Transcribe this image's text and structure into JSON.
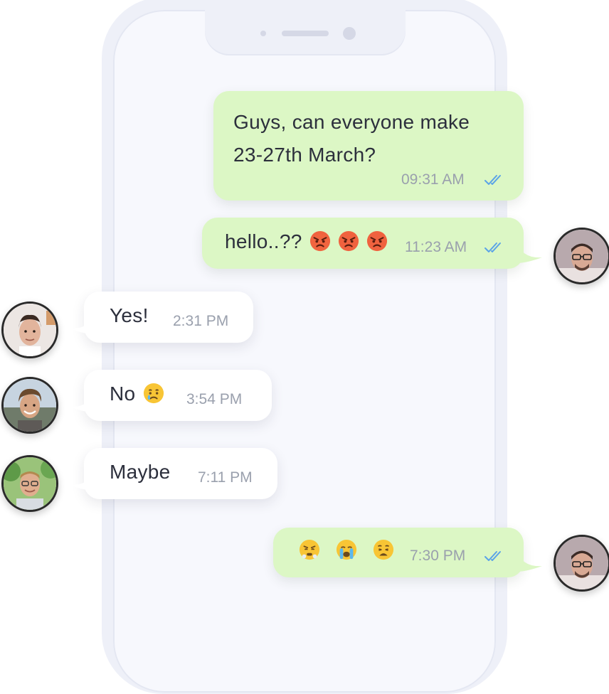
{
  "messages": [
    {
      "id": "m1",
      "direction": "sent",
      "lines": [
        "Guys, can everyone make",
        "23-27th March?"
      ],
      "time": "09:31 AM",
      "read": true
    },
    {
      "id": "m2",
      "direction": "sent",
      "text": "hello..??",
      "emojis": [
        "angry-face",
        "angry-face",
        "angry-face"
      ],
      "time": "11:23 AM",
      "read": true,
      "avatar": "man-glasses-avatar"
    },
    {
      "id": "m3",
      "direction": "received",
      "text": "Yes!",
      "time": "2:31 PM",
      "avatar": "man-short-hair-avatar"
    },
    {
      "id": "m4",
      "direction": "received",
      "text": "No",
      "emojis": [
        "crying-face"
      ],
      "time": "3:54 PM",
      "avatar": "man-smiling-avatar"
    },
    {
      "id": "m5",
      "direction": "received",
      "text": "Maybe",
      "time": "7:11 PM",
      "avatar": "man-outdoor-glasses-avatar"
    },
    {
      "id": "m6",
      "direction": "sent",
      "text": "",
      "emojis": [
        "steam-nose-face",
        "loudly-crying-face",
        "weary-face"
      ],
      "time": "7:30 PM",
      "read": true,
      "avatar": "man-glasses-avatar"
    }
  ],
  "colors": {
    "sent_bubble": "#dcf7c5",
    "received_bubble": "#ffffff",
    "read_ticks": "#5aa3e8",
    "text": "#2c2f3c",
    "time": "#9aa0ad"
  }
}
